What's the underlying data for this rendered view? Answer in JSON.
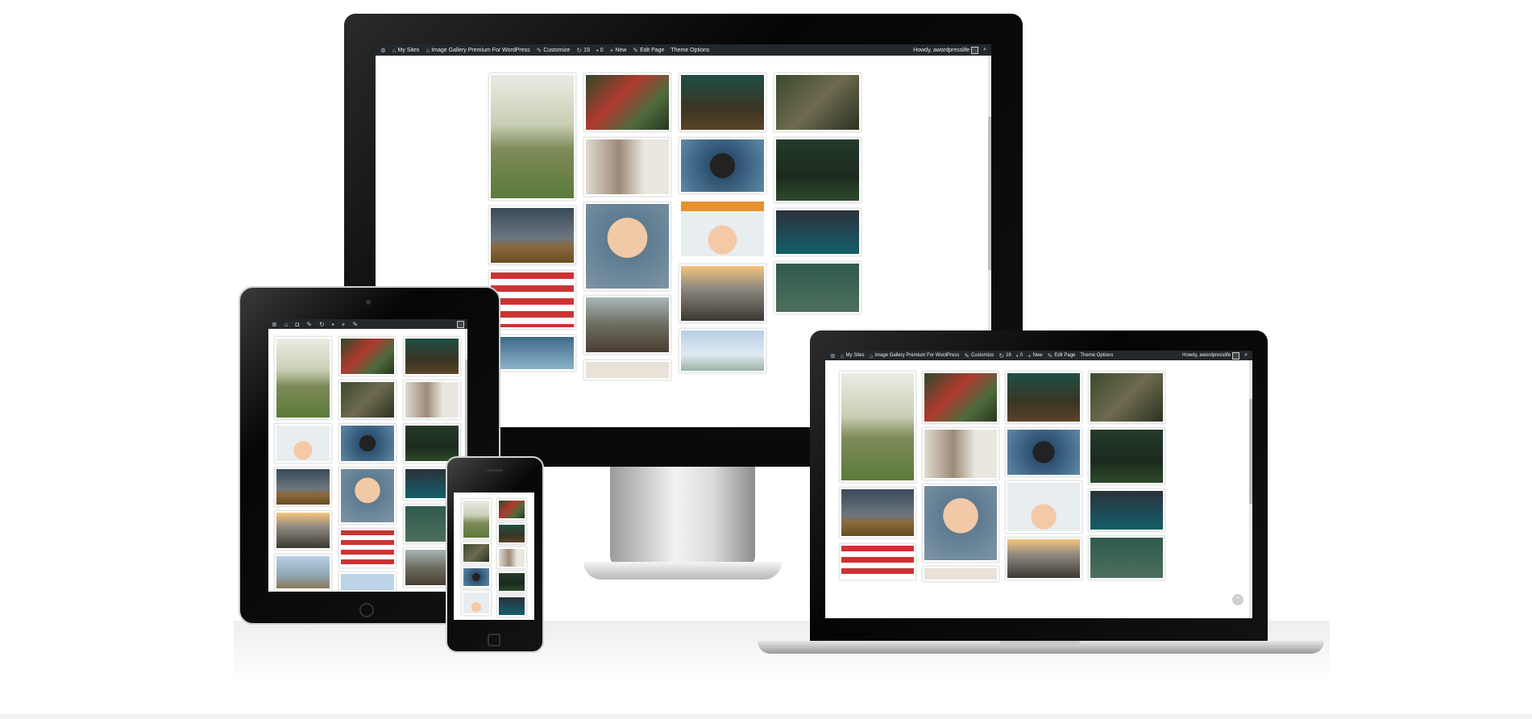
{
  "admin_bar": {
    "my_sites": "My Sites",
    "site_name": "Image Gallery Premium For WordPress",
    "customize": "Customize",
    "updates": "19",
    "comments": "0",
    "new": "New",
    "edit_page": "Edit Page",
    "theme_options": "Theme Options",
    "howdy": "Howdy, awordpresslife"
  },
  "icons": {
    "wordpress": "wordpress-logo-icon",
    "sites": "my-sites-icon",
    "camera": "customize-camera-icon",
    "updates": "updates-icon",
    "comments": "comments-icon",
    "new": "plus-icon",
    "edit": "pencil-icon",
    "search": "search-icon",
    "scroll_top": "scroll-top-icon"
  },
  "colors": {
    "admin_bar": "#23282d",
    "bezel": "#0b0b0b",
    "background": "#ffffff"
  }
}
